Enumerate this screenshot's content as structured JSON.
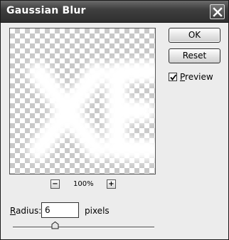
{
  "dialog": {
    "title": "Gaussian Blur",
    "ok_label": "OK",
    "reset_label": "Reset",
    "preview": {
      "label_accel": "P",
      "label_rest": "review",
      "checked": true
    }
  },
  "zoom": {
    "minus": "−",
    "plus": "+",
    "level": "100%"
  },
  "radius": {
    "label_accel": "R",
    "label_rest": "adius:",
    "value": "6",
    "unit": "pixels",
    "slider_fraction": 0.3
  },
  "icons": {
    "close": "close-icon",
    "check": "checkmark-icon"
  }
}
